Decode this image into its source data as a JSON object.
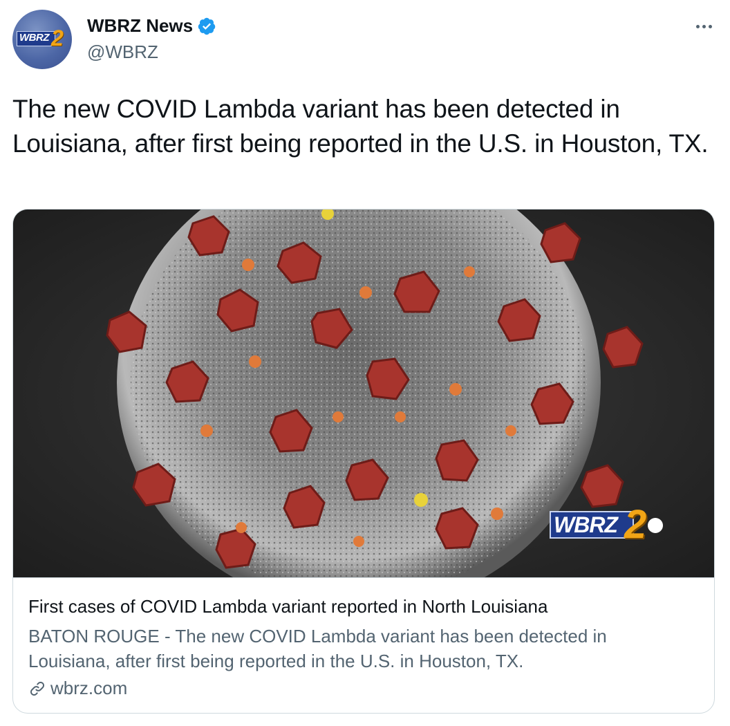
{
  "account": {
    "display_name": "WBRZ News",
    "handle": "@WBRZ",
    "verified": true,
    "avatar_logo_text": "WBRZ",
    "avatar_logo_number": "2"
  },
  "tweet": {
    "text": "The new COVID Lambda variant has been detected in Louisiana, after first being reported in the U.S. in Houston, TX."
  },
  "card": {
    "image_icon": "coronavirus-image",
    "watermark_text": "WBRZ",
    "watermark_number": "2",
    "title": "First cases of COVID Lambda variant reported in North Louisiana",
    "description": "BATON ROUGE - The new COVID Lambda variant has been detected in Louisiana, after first being reported in the U.S. in Houston, TX.",
    "domain": "wbrz.com"
  },
  "icons": {
    "verified": "verified-badge-icon",
    "more": "more-options-icon",
    "link": "link-icon"
  },
  "colors": {
    "verified_blue": "#1d9bf0",
    "text_primary": "#0f1419",
    "text_secondary": "#536471",
    "border": "#cfd9de"
  }
}
